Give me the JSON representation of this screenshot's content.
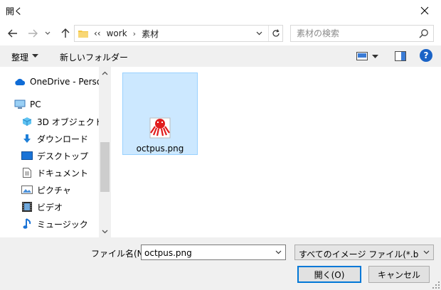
{
  "window": {
    "title": "開く"
  },
  "address": {
    "prefix": "‹‹",
    "crumbs": [
      "work",
      "素材"
    ]
  },
  "search": {
    "placeholder": "素材の検索"
  },
  "toolbar": {
    "organize": "整理",
    "new_folder": "新しいフォルダー",
    "help": "?"
  },
  "nav_items": [
    {
      "label": "OneDrive - Personal",
      "icon": "onedrive-icon"
    },
    {
      "label": "PC",
      "icon": "pc-icon"
    },
    {
      "label": "3D オブジェクト",
      "icon": "3d-objects-icon"
    },
    {
      "label": "ダウンロード",
      "icon": "download-icon"
    },
    {
      "label": "デスクトップ",
      "icon": "desktop-icon"
    },
    {
      "label": "ドキュメント",
      "icon": "documents-icon"
    },
    {
      "label": "ピクチャ",
      "icon": "pictures-icon"
    },
    {
      "label": "ビデオ",
      "icon": "videos-icon"
    },
    {
      "label": "ミュージック",
      "icon": "music-icon"
    }
  ],
  "files": [
    {
      "name": "octpus.png",
      "icon": "octopus-thumbnail"
    }
  ],
  "bottom": {
    "filename_label": "ファイル名(N):",
    "filename_value": "octpus.png",
    "filter": "すべてのイメージ ファイル(*.bmp,*.gif",
    "open_label": "開く(O)",
    "cancel_label": "キャンセル"
  },
  "colors": {
    "accent": "#0078d7",
    "selection": "#cce8ff",
    "selection_border": "#99d1ff",
    "octopus": "#e11d1d"
  }
}
